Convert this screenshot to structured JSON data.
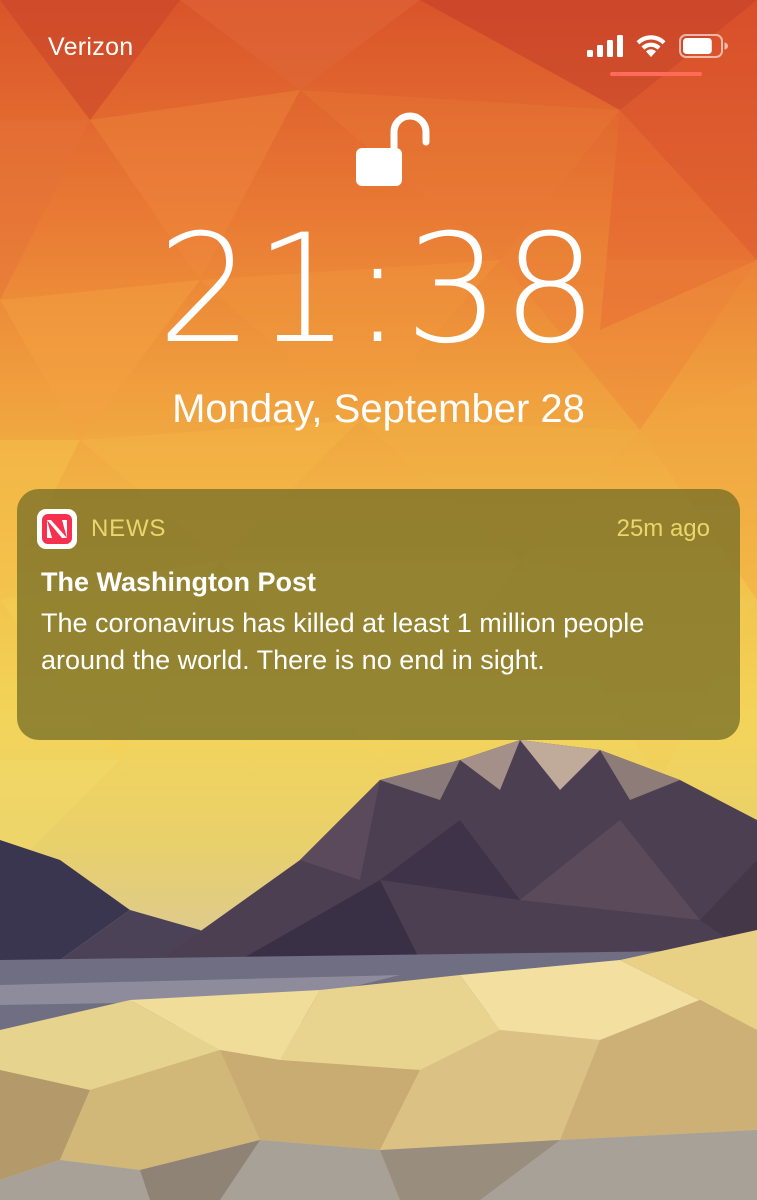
{
  "status_bar": {
    "carrier": "Verizon",
    "signal_icon": "signal-bars-icon",
    "wifi_icon": "wifi-icon",
    "battery_icon": "battery-icon",
    "battery_level": 0.8
  },
  "lock_screen": {
    "lock_icon": "unlocked-padlock-icon",
    "time": "21:38",
    "date": "Monday, September 28"
  },
  "notification": {
    "app_icon": "apple-news-icon",
    "app_name": "NEWS",
    "time_ago": "25m ago",
    "title": "The Washington Post",
    "body": "The coronavirus has killed at least 1 million people around the world. There is no end in sight."
  },
  "colors": {
    "accent_text": "#e8d76a",
    "news_red": "#f6304f",
    "indicator": "#ff6a5a"
  }
}
